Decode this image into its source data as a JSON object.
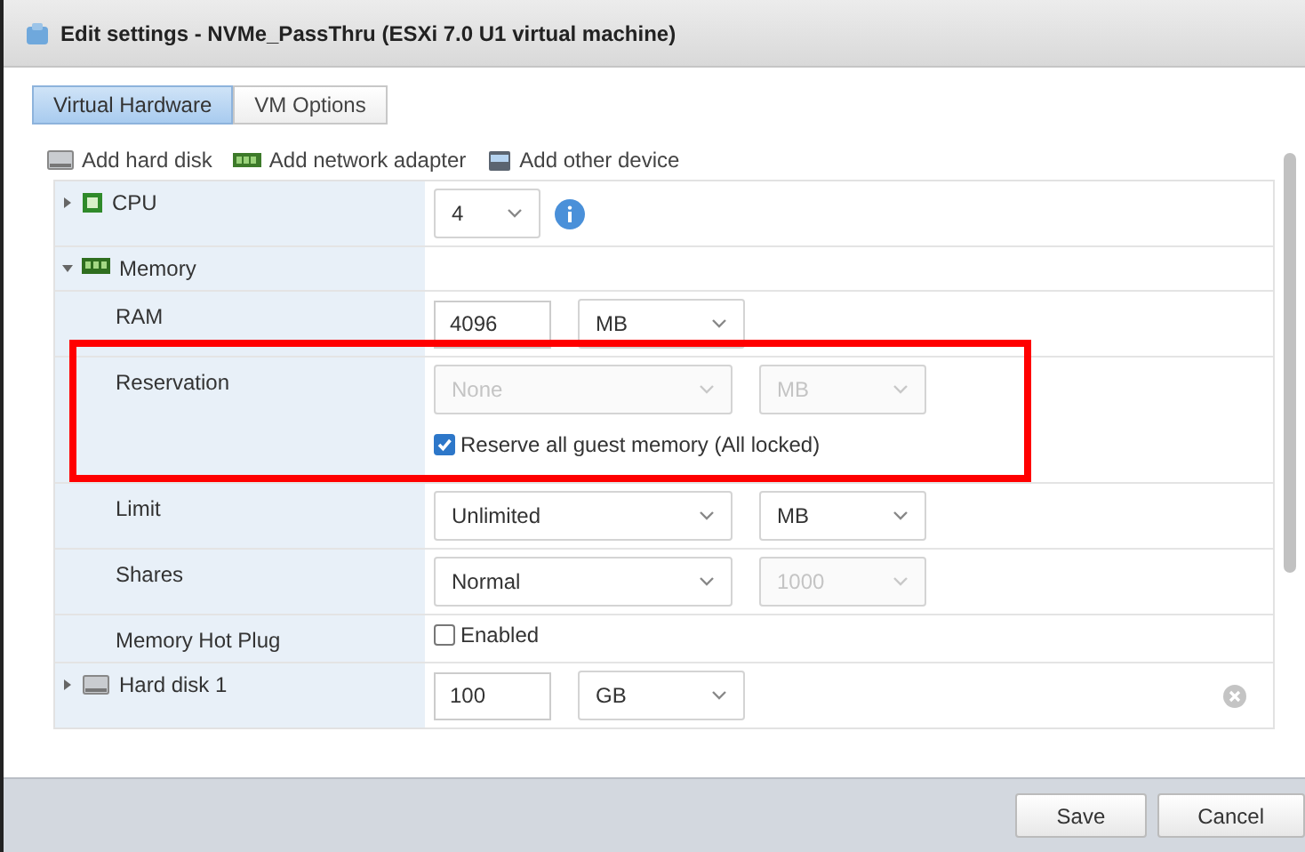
{
  "window": {
    "title": "Edit settings - NVMe_PassThru (ESXi 7.0 U1 virtual machine)"
  },
  "tabs": [
    {
      "label": "Virtual Hardware",
      "selected": true
    },
    {
      "label": "VM Options",
      "selected": false
    }
  ],
  "toolbar": [
    {
      "kind": "disk",
      "label": "Add hard disk"
    },
    {
      "kind": "network",
      "label": "Add network adapter"
    },
    {
      "kind": "device",
      "label": "Add other device"
    }
  ],
  "rows": [
    {
      "kind": "cpu",
      "label": "CPU",
      "expanded": false,
      "highlighted": false,
      "controls": [
        {
          "kind": "count",
          "value": "4",
          "disabled": false
        },
        {
          "kind": "info"
        }
      ]
    },
    {
      "kind": "memory",
      "label": "Memory",
      "expanded": true,
      "highlighted": false,
      "controls": []
    },
    {
      "kind": "field",
      "label": "RAM",
      "highlighted": false,
      "controls": [
        {
          "kind": "input",
          "value": "4096"
        },
        {
          "kind": "dropdown",
          "value": "MB",
          "disabled": false
        }
      ]
    },
    {
      "kind": "field",
      "label": "Reservation",
      "highlighted": true,
      "controls": [
        {
          "kind": "dropdown",
          "value": "None",
          "disabled": true
        },
        {
          "kind": "dropdown",
          "value": "MB",
          "disabled": true
        }
      ],
      "checkbox": {
        "label": "Reserve all guest memory (All locked)",
        "checked": true
      }
    },
    {
      "kind": "field",
      "label": "Limit",
      "highlighted": false,
      "controls": [
        {
          "kind": "dropdown",
          "value": "Unlimited",
          "disabled": false
        },
        {
          "kind": "dropdown",
          "value": "MB",
          "disabled": false
        }
      ]
    },
    {
      "kind": "field",
      "label": "Shares",
      "highlighted": false,
      "controls": [
        {
          "kind": "dropdown",
          "value": "Normal",
          "disabled": false
        },
        {
          "kind": "dropdown",
          "value": "1000",
          "disabled": true
        }
      ]
    },
    {
      "kind": "field",
      "label": "Memory Hot Plug",
      "highlighted": false,
      "controls": [
        {
          "kind": "checkbox",
          "label": "Enabled",
          "checked": false
        }
      ]
    },
    {
      "kind": "disk",
      "label": "Hard disk 1",
      "expanded": false,
      "highlighted": false,
      "removable": true,
      "controls": [
        {
          "kind": "input",
          "value": "100"
        },
        {
          "kind": "dropdown",
          "value": "GB",
          "disabled": false
        }
      ]
    }
  ],
  "buttons": [
    "Save",
    "Cancel"
  ]
}
